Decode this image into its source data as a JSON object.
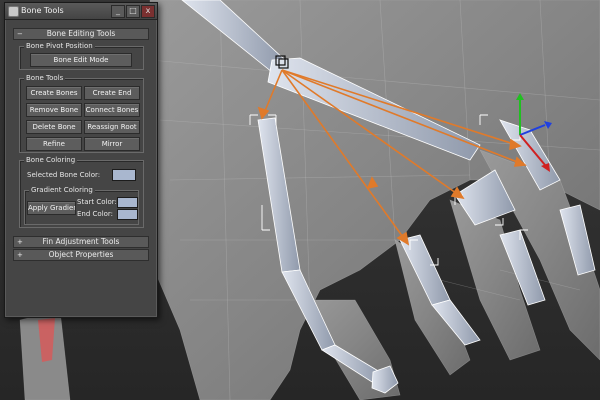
{
  "window": {
    "title": "Bone Tools",
    "minimize_glyph": "_",
    "maximize_glyph": "□",
    "close_glyph": "x"
  },
  "rollouts": {
    "bone_editing": {
      "toggle": "−",
      "label": "Bone Editing Tools"
    },
    "fin_adjustment": {
      "toggle": "+",
      "label": "Fin Adjustment Tools"
    },
    "object_properties": {
      "toggle": "+",
      "label": "Object Properties"
    }
  },
  "bone_pivot": {
    "label": "Bone Pivot Position",
    "edit_mode_button": "Bone Edit Mode"
  },
  "bone_tools": {
    "label": "Bone Tools",
    "create_bones": "Create Bones",
    "create_end": "Create End",
    "remove_bone": "Remove Bone",
    "connect_bones": "Connect Bones",
    "delete_bone": "Delete Bone",
    "reassign_root": "Reassign Root",
    "refine": "Refine",
    "mirror": "Mirror"
  },
  "bone_coloring": {
    "label": "Bone Coloring",
    "selected_color_label": "Selected Bone Color:",
    "selected_color": "#a9b7cf",
    "gradient": {
      "label": "Gradient Coloring",
      "apply_button": "Apply Gradient",
      "start_label": "Start Color:",
      "start_color": "#a9b7cf",
      "end_label": "End Color:",
      "end_color": "#a9b7cf"
    }
  },
  "colors": {
    "viewport_bg": "#2d2d2d",
    "hand_mesh": "#8a8a8a",
    "bone_fill": "#b9c2d2",
    "link_orange": "#e07a2a",
    "gizmo_x": "#d02020",
    "gizmo_y": "#20c020",
    "gizmo_z": "#2040e0"
  },
  "icons": [
    "bone-tools-icon",
    "minimize-icon",
    "maximize-icon",
    "close-icon",
    "rollout-toggle-icon",
    "transform-gizmo-icon",
    "bone-pivot-icon"
  ]
}
